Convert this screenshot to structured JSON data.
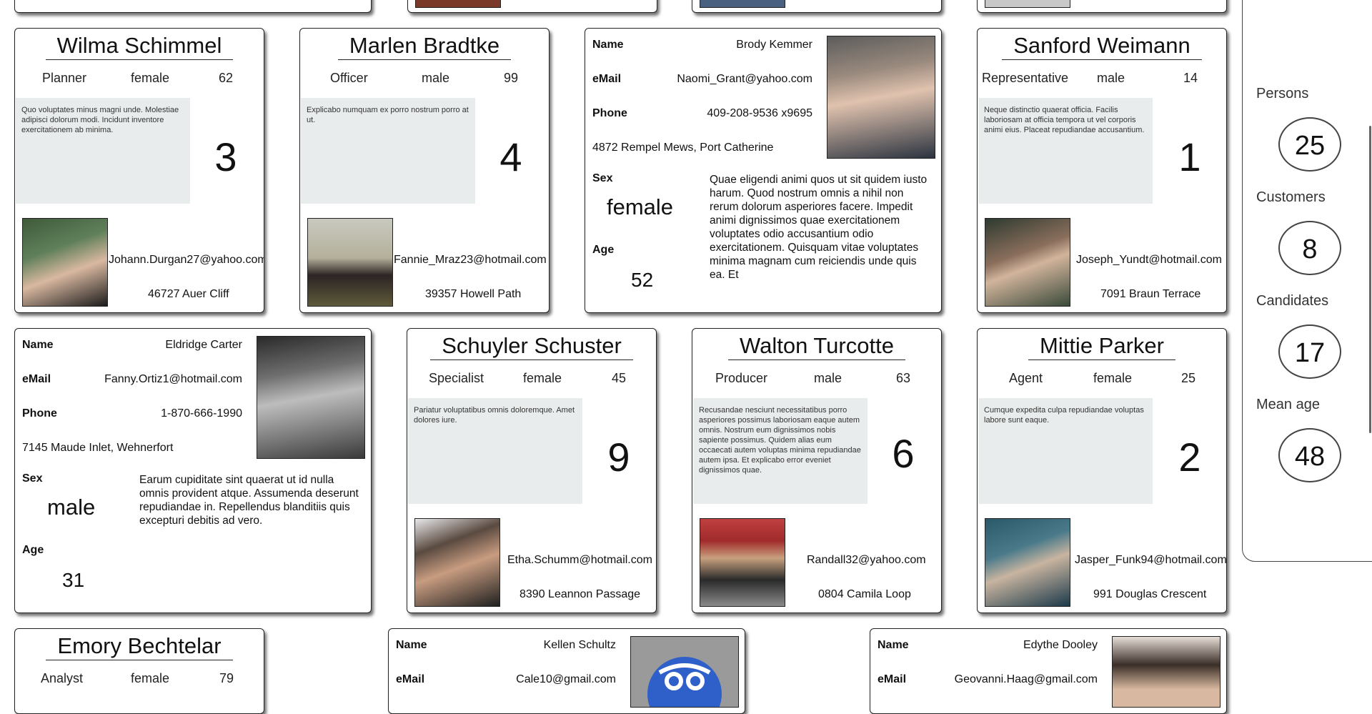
{
  "simple_cards": [
    {
      "name": "Wilma Schimmel",
      "role": "Planner",
      "sex": "female",
      "age": "62",
      "note": "Quo voluptates minus magni unde. Molestiae adipisci dolorum modi. Incidunt inventore exercitationem ab minima.",
      "number": "3",
      "email": "Johann.Durgan27@yahoo.com",
      "address": "46727 Auer Cliff"
    },
    {
      "name": "Marlen Bradtke",
      "role": "Officer",
      "sex": "male",
      "age": "99",
      "note": "Explicabo numquam ex porro nostrum porro at ut.",
      "number": "4",
      "email": "Fannie_Mraz23@hotmail.com",
      "address": "39357 Howell Path"
    },
    {
      "name": "Sanford Weimann",
      "role": "Representative",
      "sex": "male",
      "age": "14",
      "note": "Neque distinctio quaerat officia. Facilis laboriosam at officia tempora ut vel corporis animi eius. Placeat repudiandae accusantium.",
      "number": "1",
      "email": "Joseph_Yundt@hotmail.com",
      "address": "7091 Braun Terrace"
    },
    {
      "name": "Schuyler Schuster",
      "role": "Specialist",
      "sex": "female",
      "age": "45",
      "note": "Pariatur voluptatibus omnis doloremque. Amet dolores iure.",
      "number": "9",
      "email": "Etha.Schumm@hotmail.com",
      "address": "8390 Leannon Passage"
    },
    {
      "name": "Walton Turcotte",
      "role": "Producer",
      "sex": "male",
      "age": "63",
      "note": "Recusandae nesciunt necessitatibus porro asperiores possimus laboriosam eaque autem omnis. Nostrum eum dignissimos nobis sapiente possimus. Quidem alias eum occaecati autem voluptas minima repudiandae autem ipsa. Et explicabo error eveniet dignissimos quae.",
      "number": "6",
      "email": "Randall32@yahoo.com",
      "address": "0804 Camila Loop"
    },
    {
      "name": "Mittie Parker",
      "role": "Agent",
      "sex": "female",
      "age": "25",
      "note": "Cumque expedita culpa repudiandae voluptas labore sunt eaque.",
      "number": "2",
      "email": "Jasper_Funk94@hotmail.com",
      "address": "991 Douglas Crescent"
    },
    {
      "name": "Emory Bechtelar",
      "role": "Analyst",
      "sex": "female",
      "age": "79"
    }
  ],
  "labels": {
    "name": "Name",
    "email": "eMail",
    "phone": "Phone",
    "sex": "Sex",
    "age": "Age"
  },
  "detail_cards": [
    {
      "name": "Brody Kemmer",
      "email": "Naomi_Grant@yahoo.com",
      "phone": "409-208-9536 x9695",
      "address": "4872 Rempel Mews, Port Catherine",
      "sex": "female",
      "age": "52",
      "desc": "Quae eligendi animi quos ut sit quidem iusto harum. Quod nostrum omnis a nihil non rerum dolorum asperiores facere. Impedit animi dignissimos quae exercitationem voluptates odio accusantium odio exercitationem. Quisquam vitae voluptates minima magnam cum reiciendis unde quis ea. Et"
    },
    {
      "name": "Eldridge Carter",
      "email": "Fanny.Ortiz1@hotmail.com",
      "phone": "1-870-666-1990",
      "address": "7145 Maude Inlet, Wehnerfort",
      "sex": "male",
      "age": "31",
      "desc": "Earum cupiditate sint quaerat ut id nulla omnis provident atque. Assumenda deserunt repudiandae in. Repellendus blanditiis quis excepturi debitis ad vero."
    },
    {
      "name": "Kellen Schultz",
      "email": "Cale10@gmail.com"
    },
    {
      "name": "Edythe Dooley",
      "email": "Geovanni.Haag@gmail.com"
    }
  ],
  "stats": [
    {
      "label": "Persons",
      "value": "25"
    },
    {
      "label": "Customers",
      "value": "8"
    },
    {
      "label": "Candidates",
      "value": "17"
    },
    {
      "label": "Mean age",
      "value": "48"
    }
  ]
}
